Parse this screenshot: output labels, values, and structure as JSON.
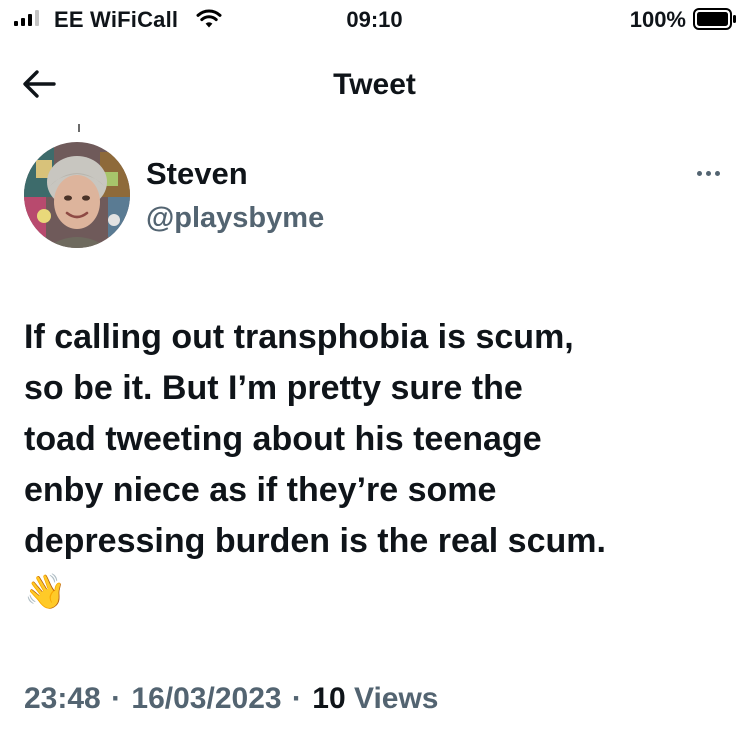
{
  "status_bar": {
    "carrier": "EE WiFiCall",
    "time": "09:10",
    "battery": "100%",
    "icons": [
      "cellular-signal-icon",
      "wifi-icon",
      "battery-icon"
    ]
  },
  "header": {
    "title": "Tweet",
    "back_icon": "arrow-left-icon"
  },
  "tweet": {
    "author": {
      "name": "Steven",
      "handle": "@playsbyme"
    },
    "more_icon": "ellipsis-icon",
    "text": "If calling out transphobia is scum,\nso be it. But I’m pretty sure the\ntoad tweeting about his teenage\nenby niece as if they’re some\ndepressing burden is the real scum.\n👋",
    "time": "23:48",
    "date": "16/03/2023",
    "separator": "·",
    "views_count": "10",
    "views_label": "Views"
  },
  "colors": {
    "text_primary": "#0f1419",
    "text_secondary": "#536471",
    "background": "#ffffff"
  }
}
